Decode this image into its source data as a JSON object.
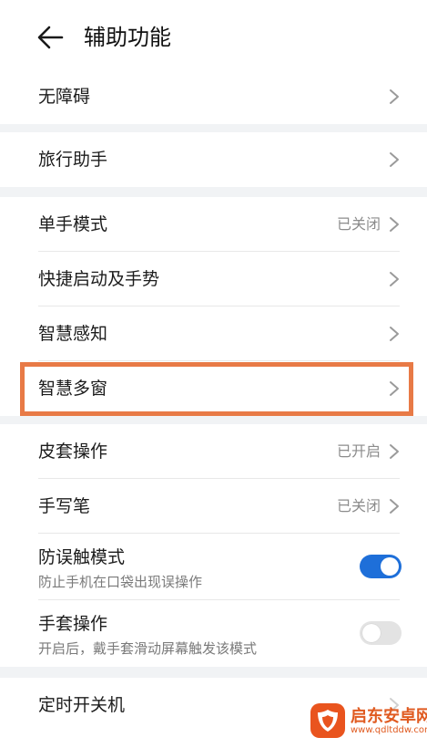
{
  "header": {
    "title": "辅助功能"
  },
  "groups": [
    {
      "rows": [
        {
          "label": "无障碍"
        }
      ]
    },
    {
      "rows": [
        {
          "label": "旅行助手"
        }
      ]
    },
    {
      "rows": [
        {
          "label": "单手模式",
          "status": "已关闭"
        },
        {
          "label": "快捷启动及手势"
        },
        {
          "label": "智慧感知"
        },
        {
          "label": "智慧多窗"
        }
      ]
    },
    {
      "rows": [
        {
          "label": "皮套操作",
          "status": "已开启"
        },
        {
          "label": "手写笔",
          "status": "已关闭"
        },
        {
          "label": "防误触模式",
          "sublabel": "防止手机在口袋出现误操作",
          "toggle": "on"
        },
        {
          "label": "手套操作",
          "sublabel": "开启后，戴手套滑动屏幕触发该模式",
          "toggle": "off"
        }
      ]
    },
    {
      "rows": [
        {
          "label": "定时开关机"
        }
      ]
    }
  ],
  "watermark": {
    "text": "启东安卓网",
    "url": "www.qdltddw.com"
  },
  "colors": {
    "accent": "#1e6fd9",
    "highlight": "#e87a46",
    "background": "#f1f3f5"
  }
}
